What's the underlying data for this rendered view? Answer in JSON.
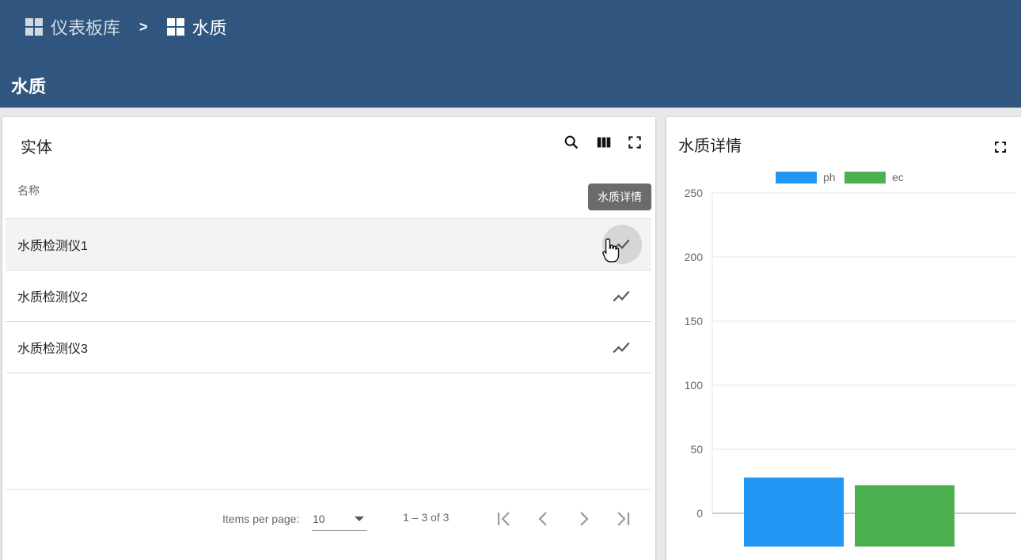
{
  "breadcrumb": {
    "items": [
      {
        "label": "仪表板库",
        "icon": "dashboard-icon"
      },
      {
        "label": "水质",
        "icon": "dashboard-icon"
      }
    ],
    "separator": ">"
  },
  "page": {
    "title": "水质"
  },
  "entities_widget": {
    "title": "实体",
    "column_name": "名称",
    "tooltip": "水质详情",
    "rows": [
      {
        "name": "水质检测仪1",
        "action_icon": "timeline-icon"
      },
      {
        "name": "水质检测仪2",
        "action_icon": "timeline-icon"
      },
      {
        "name": "水质检测仪3",
        "action_icon": "timeline-icon"
      }
    ],
    "paginator": {
      "items_per_page_label": "Items per page:",
      "items_per_page_value": "10",
      "range_label": "1 – 3 of 3"
    }
  },
  "chart_widget": {
    "title": "水质详情"
  },
  "colors": {
    "header": "#305680",
    "ph": "#2196f3",
    "ec": "#4caf50"
  },
  "chart_data": {
    "type": "bar",
    "title": "",
    "series": [
      {
        "name": "ph",
        "values": [
          28
        ]
      },
      {
        "name": "ec",
        "values": [
          22
        ]
      }
    ],
    "categories": [
      ""
    ],
    "ylim": [
      0,
      250
    ],
    "yticks": [
      0,
      50,
      100,
      150,
      200,
      250
    ],
    "grid": true,
    "legend": "top"
  }
}
